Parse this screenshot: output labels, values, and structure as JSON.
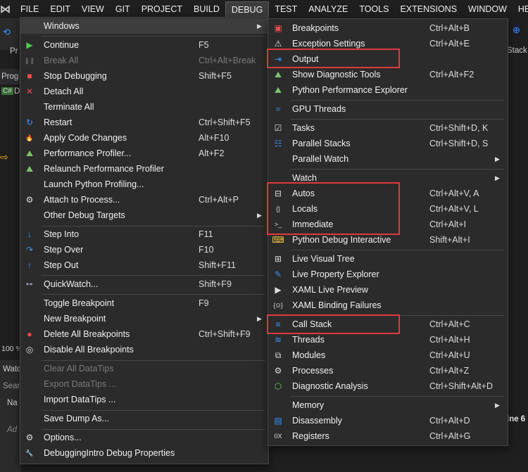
{
  "menubar": [
    "FILE",
    "EDIT",
    "VIEW",
    "GIT",
    "PROJECT",
    "BUILD",
    "DEBUG",
    "TEST",
    "ANALYZE",
    "TOOLS",
    "EXTENSIONS",
    "WINDOW",
    "HEI"
  ],
  "background": {
    "pr": "Pr",
    "prog": "Prog",
    "d_tab": "D",
    "zoom": "100 %",
    "watch": "Watc",
    "search": "Sear",
    "name": "Na",
    "add": "Ad",
    "stack": "Stack",
    "line": "ine 6"
  },
  "debug_menu": {
    "items": [
      {
        "icon": "",
        "label": "Windows",
        "shortcut": "",
        "submenu": true,
        "disabled": false
      },
      {
        "icon": "continue-icon",
        "label": "Continue",
        "shortcut": "F5",
        "submenu": false,
        "disabled": false
      },
      {
        "icon": "pause-icon",
        "label": "Break All",
        "shortcut": "Ctrl+Alt+Break",
        "submenu": false,
        "disabled": true
      },
      {
        "icon": "stop-icon",
        "label": "Stop Debugging",
        "shortcut": "Shift+F5",
        "submenu": false,
        "disabled": false
      },
      {
        "icon": "detach-icon",
        "label": "Detach All",
        "shortcut": "",
        "submenu": false,
        "disabled": false
      },
      {
        "icon": "",
        "label": "Terminate All",
        "shortcut": "",
        "submenu": false,
        "disabled": false
      },
      {
        "icon": "restart-icon",
        "label": "Restart",
        "shortcut": "Ctrl+Shift+F5",
        "submenu": false,
        "disabled": false
      },
      {
        "icon": "hot-reload-icon",
        "label": "Apply Code Changes",
        "shortcut": "Alt+F10",
        "submenu": false,
        "disabled": false
      },
      {
        "icon": "profiler-icon",
        "label": "Performance Profiler...",
        "shortcut": "Alt+F2",
        "submenu": false,
        "disabled": false
      },
      {
        "icon": "relaunch-profiler-icon",
        "label": "Relaunch Performance Profiler",
        "shortcut": "",
        "submenu": false,
        "disabled": false
      },
      {
        "icon": "",
        "label": "Launch Python Profiling...",
        "shortcut": "",
        "submenu": false,
        "disabled": false
      },
      {
        "icon": "attach-icon",
        "label": "Attach to Process...",
        "shortcut": "Ctrl+Alt+P",
        "submenu": false,
        "disabled": false
      },
      {
        "icon": "",
        "label": "Other Debug Targets",
        "shortcut": "",
        "submenu": true,
        "disabled": false
      },
      {
        "icon": "step-into-icon",
        "label": "Step Into",
        "shortcut": "F11",
        "submenu": false,
        "disabled": false
      },
      {
        "icon": "step-over-icon",
        "label": "Step Over",
        "shortcut": "F10",
        "submenu": false,
        "disabled": false
      },
      {
        "icon": "step-out-icon",
        "label": "Step Out",
        "shortcut": "Shift+F11",
        "submenu": false,
        "disabled": false
      },
      {
        "icon": "quickwatch-icon",
        "label": "QuickWatch...",
        "shortcut": "Shift+F9",
        "submenu": false,
        "disabled": false
      },
      {
        "icon": "",
        "label": "Toggle Breakpoint",
        "shortcut": "F9",
        "submenu": false,
        "disabled": false
      },
      {
        "icon": "",
        "label": "New Breakpoint",
        "shortcut": "",
        "submenu": true,
        "disabled": false
      },
      {
        "icon": "delete-breakpoints-icon",
        "label": "Delete All Breakpoints",
        "shortcut": "Ctrl+Shift+F9",
        "submenu": false,
        "disabled": false
      },
      {
        "icon": "disable-breakpoints-icon",
        "label": "Disable All Breakpoints",
        "shortcut": "",
        "submenu": false,
        "disabled": false
      },
      {
        "icon": "",
        "label": "Clear All DataTips",
        "shortcut": "",
        "submenu": false,
        "disabled": true
      },
      {
        "icon": "",
        "label": "Export DataTips ...",
        "shortcut": "",
        "submenu": false,
        "disabled": true
      },
      {
        "icon": "",
        "label": "Import DataTips ...",
        "shortcut": "",
        "submenu": false,
        "disabled": false
      },
      {
        "icon": "",
        "label": "Save Dump As...",
        "shortcut": "",
        "submenu": false,
        "disabled": false
      },
      {
        "icon": "gear-icon",
        "label": "Options...",
        "shortcut": "",
        "submenu": false,
        "disabled": false
      },
      {
        "icon": "wrench-icon",
        "label": "DebuggingIntro Debug Properties",
        "shortcut": "",
        "submenu": false,
        "disabled": false
      }
    ]
  },
  "windows_submenu": {
    "items": [
      {
        "icon": "breakpoints-icon",
        "label": "Breakpoints",
        "shortcut": "Ctrl+Alt+B",
        "submenu": false
      },
      {
        "icon": "exception-settings-icon",
        "label": "Exception Settings",
        "shortcut": "Ctrl+Alt+E",
        "submenu": false
      },
      {
        "icon": "output-icon",
        "label": "Output",
        "shortcut": "",
        "submenu": false
      },
      {
        "icon": "diagnostic-tools-icon",
        "label": "Show Diagnostic Tools",
        "shortcut": "Ctrl+Alt+F2",
        "submenu": false
      },
      {
        "icon": "python-performance-icon",
        "label": "Python Performance Explorer",
        "shortcut": "",
        "submenu": false
      },
      {
        "icon": "gpu-threads-icon",
        "label": "GPU Threads",
        "shortcut": "",
        "submenu": false
      },
      {
        "icon": "tasks-icon",
        "label": "Tasks",
        "shortcut": "Ctrl+Shift+D, K",
        "submenu": false
      },
      {
        "icon": "parallel-stacks-icon",
        "label": "Parallel Stacks",
        "shortcut": "Ctrl+Shift+D, S",
        "submenu": false
      },
      {
        "icon": "",
        "label": "Parallel Watch",
        "shortcut": "",
        "submenu": true
      },
      {
        "icon": "",
        "label": "Watch",
        "shortcut": "",
        "submenu": true
      },
      {
        "icon": "autos-icon",
        "label": "Autos",
        "shortcut": "Ctrl+Alt+V, A",
        "submenu": false
      },
      {
        "icon": "locals-icon",
        "label": "Locals",
        "shortcut": "Ctrl+Alt+V, L",
        "submenu": false
      },
      {
        "icon": "immediate-icon",
        "label": "Immediate",
        "shortcut": "Ctrl+Alt+I",
        "submenu": false
      },
      {
        "icon": "python-interactive-icon",
        "label": "Python Debug Interactive",
        "shortcut": "Shift+Alt+I",
        "submenu": false
      },
      {
        "icon": "live-visual-tree-icon",
        "label": "Live Visual Tree",
        "shortcut": "",
        "submenu": false
      },
      {
        "icon": "live-property-icon",
        "label": "Live Property Explorer",
        "shortcut": "",
        "submenu": false
      },
      {
        "icon": "xaml-preview-icon",
        "label": "XAML Live Preview",
        "shortcut": "",
        "submenu": false
      },
      {
        "icon": "xaml-binding-icon",
        "label": "XAML Binding Failures",
        "shortcut": "",
        "submenu": false
      },
      {
        "icon": "call-stack-icon",
        "label": "Call Stack",
        "shortcut": "Ctrl+Alt+C",
        "submenu": false
      },
      {
        "icon": "threads-icon",
        "label": "Threads",
        "shortcut": "Ctrl+Alt+H",
        "submenu": false
      },
      {
        "icon": "modules-icon",
        "label": "Modules",
        "shortcut": "Ctrl+Alt+U",
        "submenu": false
      },
      {
        "icon": "processes-icon",
        "label": "Processes",
        "shortcut": "Ctrl+Alt+Z",
        "submenu": false
      },
      {
        "icon": "diagnostic-analysis-icon",
        "label": "Diagnostic Analysis",
        "shortcut": "Ctrl+Shift+Alt+D",
        "submenu": false
      },
      {
        "icon": "",
        "label": "Memory",
        "shortcut": "",
        "submenu": true
      },
      {
        "icon": "disassembly-icon",
        "label": "Disassembly",
        "shortcut": "Ctrl+Alt+D",
        "submenu": false
      },
      {
        "icon": "registers-icon",
        "label": "Registers",
        "shortcut": "Ctrl+Alt+G",
        "submenu": false
      }
    ]
  },
  "colors": {
    "highlight_box": "#e0393e",
    "menu_bg": "#2b2b2b",
    "accent_blue": "#3794ff",
    "stop_red": "#f14c4c",
    "continue_green": "#4ec94e"
  }
}
